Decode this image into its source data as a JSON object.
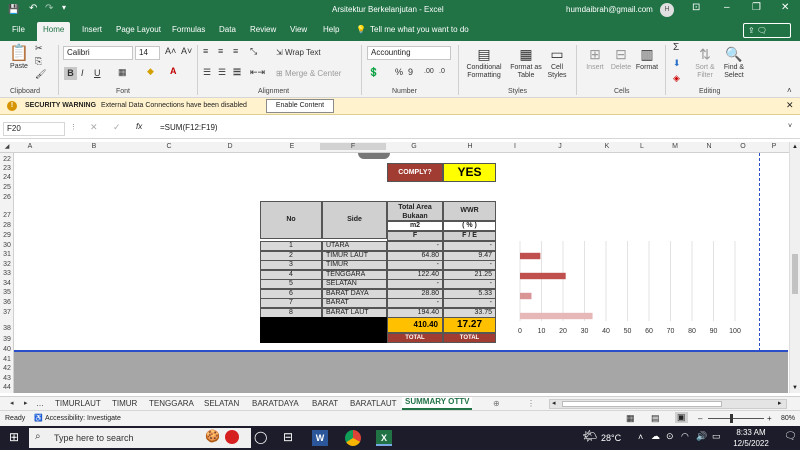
{
  "app": {
    "title": "Arsitektur Berkelanjutan  -  Excel",
    "user_email": "humdaibrah@gmail.com",
    "user_initial": "H"
  },
  "ribbon_tabs": [
    "File",
    "Home",
    "Insert",
    "Page Layout",
    "Formulas",
    "Data",
    "Review",
    "View",
    "Help"
  ],
  "tell_me": "Tell me what you want to do",
  "ribbon": {
    "clipboard": {
      "paste": "Paste",
      "label": "Clipboard"
    },
    "font": {
      "name": "Calibri",
      "size": "14",
      "label": "Font"
    },
    "alignment": {
      "wrap": "Wrap Text",
      "merge": "Merge & Center",
      "label": "Alignment"
    },
    "number": {
      "format": "Accounting",
      "label": "Number"
    },
    "styles": {
      "conditional": "Conditional\nFormatting",
      "format_table": "Format as\nTable",
      "cell_styles": "Cell\nStyles",
      "label": "Styles"
    },
    "cells": {
      "insert": "Insert",
      "delete": "Delete",
      "format": "Format",
      "label": "Cells"
    },
    "editing": {
      "sort": "Sort &\nFilter",
      "find": "Find &\nSelect",
      "label": "Editing"
    }
  },
  "security": {
    "title": "SECURITY WARNING",
    "message": "External Data Connections have been disabled",
    "button": "Enable Content"
  },
  "formula_bar": {
    "name_box": "F20",
    "fx": "fx",
    "formula": "=SUM(F12:F19)"
  },
  "columns": [
    "A",
    "B",
    "C",
    "D",
    "E",
    "F",
    "G",
    "H",
    "I",
    "J",
    "K",
    "L",
    "M",
    "N",
    "O",
    "P"
  ],
  "rows": [
    "22",
    "23",
    "24",
    "25",
    "26",
    "27",
    "28",
    "29",
    "30",
    "31",
    "32",
    "33",
    "34",
    "35",
    "36",
    "37",
    "38",
    "39",
    "40",
    "41",
    "42",
    "43",
    "44"
  ],
  "comply": {
    "label": "COMPLY?",
    "value": "YES",
    "colors": {
      "label_bg": "#a13c32",
      "value_bg": "#ffff00"
    }
  },
  "table": {
    "headers": {
      "no": "No",
      "side": "Side",
      "area": "Total Area Bukaan",
      "wwr": "WWR",
      "area_unit": "m2",
      "wwr_unit": "( % )",
      "area_sym": "F",
      "wwr_sym": "F / E"
    },
    "rows": [
      {
        "no": "1",
        "side": "UTARA",
        "area": "-",
        "wwr": "-"
      },
      {
        "no": "2",
        "side": "TIMUR LAUT",
        "area": "64.80",
        "wwr": "9.47"
      },
      {
        "no": "3",
        "side": "TIMUR",
        "area": "-",
        "wwr": "-"
      },
      {
        "no": "4",
        "side": "TENGGARA",
        "area": "122.40",
        "wwr": "21.25"
      },
      {
        "no": "5",
        "side": "SELATAN",
        "area": "-",
        "wwr": "-"
      },
      {
        "no": "6",
        "side": "BARAT DAYA",
        "area": "28.80",
        "wwr": "5.33"
      },
      {
        "no": "7",
        "side": "BARAT",
        "area": "-",
        "wwr": "-"
      },
      {
        "no": "8",
        "side": "BARAT LAUT",
        "area": "194.40",
        "wwr": "33.75"
      }
    ],
    "total_area": "410.40",
    "total_wwr": "17.27",
    "total_label": "TOTAL",
    "total_label2": "TOTAL"
  },
  "chart_data": {
    "type": "bar",
    "orientation": "horizontal",
    "values": [
      0,
      9.47,
      0,
      21.25,
      0,
      5.33,
      0,
      33.75
    ],
    "xlim": [
      0,
      100
    ],
    "xticks": [
      "0",
      "10",
      "20",
      "30",
      "40",
      "50",
      "60",
      "70",
      "80",
      "90",
      "100"
    ],
    "grid": true,
    "colors": [
      "#c0504d",
      "#c0504d",
      "#c0504d",
      "#c0504d",
      "#c0504d",
      "#d99694",
      "#d99694",
      "#e6b9b8"
    ]
  },
  "sheet_tabs": [
    "TIMURLAUT",
    "TIMUR",
    "TENGGARA",
    "SELATAN",
    "BARATDAYA",
    "BARAT",
    "BARATLAUT",
    "SUMMARY OTTV"
  ],
  "status": {
    "ready": "Ready",
    "accessibility": "Accessibility: Investigate",
    "zoom": "80%"
  },
  "taskbar": {
    "search": "Type here to search",
    "weather": "28°C",
    "time": "8:33 AM",
    "date": "12/5/2022"
  }
}
